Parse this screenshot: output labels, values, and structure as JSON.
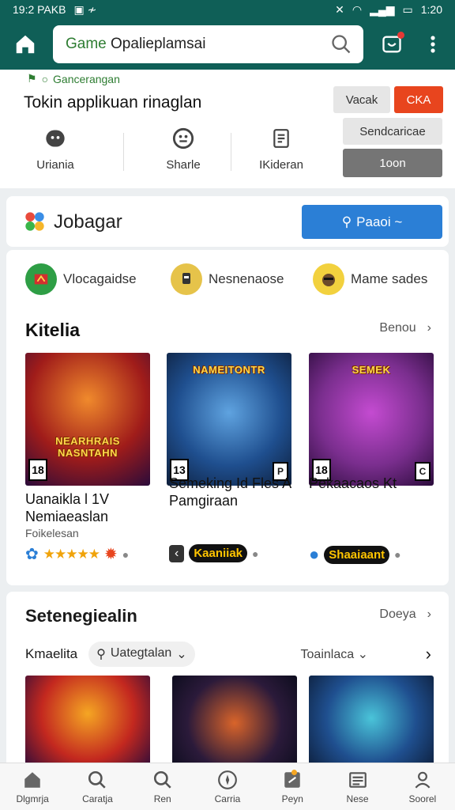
{
  "status": {
    "time_left": "19:2 PAKB",
    "time_right": "1:20"
  },
  "search": {
    "placeholder_prefix": "Game",
    "placeholder": " Opalieplamsai"
  },
  "breadcrumb": "Gancerangan",
  "page_title": "Tokin applikuan rinaglan",
  "chips": {
    "grey": "Vacak",
    "red": "CKA",
    "light": "Sendcaricae",
    "dark": "1oon"
  },
  "quick_actions": [
    {
      "icon": "smile-icon",
      "label": "Uriania"
    },
    {
      "icon": "face-icon",
      "label": "Sharle"
    },
    {
      "icon": "document-icon",
      "label": "IKideran"
    }
  ],
  "jobagar": {
    "title": "Jobagar",
    "button": "Paaoi ~"
  },
  "categories": [
    {
      "label": "Vlocagaidse",
      "color": "#2e9e45"
    },
    {
      "label": "Nesnenaose",
      "color": "#e6c34a"
    },
    {
      "label": "Mame sades",
      "color": "#f2d13e"
    }
  ],
  "section1": {
    "title": "Kitelia",
    "more": "Benou"
  },
  "games": [
    {
      "logo": "NEARHRAIS NASNTAHN",
      "rating": "18",
      "name": "Uanaikla l 1V Nemiaeaslan",
      "subtitle": "Foikelesan",
      "bg": "#c3281f"
    },
    {
      "logo": "NAMEITONTR",
      "rating": "13",
      "name": "Semeking Id Fles A Pamgiraan",
      "subtitle": "",
      "bg": "#1f4f8f"
    },
    {
      "logo": "SEMEK",
      "rating": "18",
      "name": "Pekaacaos Kt",
      "subtitle": "",
      "bg": "#7a2e8e"
    }
  ],
  "brands": [
    "Kaaniiak",
    "Shaaiaant"
  ],
  "section2": {
    "title": "Setenegiealin",
    "more": "Doeya",
    "filter_label": "Kmaelita",
    "pill": "Uategtalan",
    "dropdown": "Toainlaca"
  },
  "nav": [
    {
      "icon": "home-icon",
      "label": "Dlgmrja"
    },
    {
      "icon": "search-icon",
      "label": "Caratja"
    },
    {
      "icon": "search-icon",
      "label": "Ren"
    },
    {
      "icon": "compass-icon",
      "label": "Carria"
    },
    {
      "icon": "tag-icon",
      "label": "Peyn"
    },
    {
      "icon": "news-icon",
      "label": "Nese"
    },
    {
      "icon": "person-icon",
      "label": "Soorel"
    }
  ]
}
